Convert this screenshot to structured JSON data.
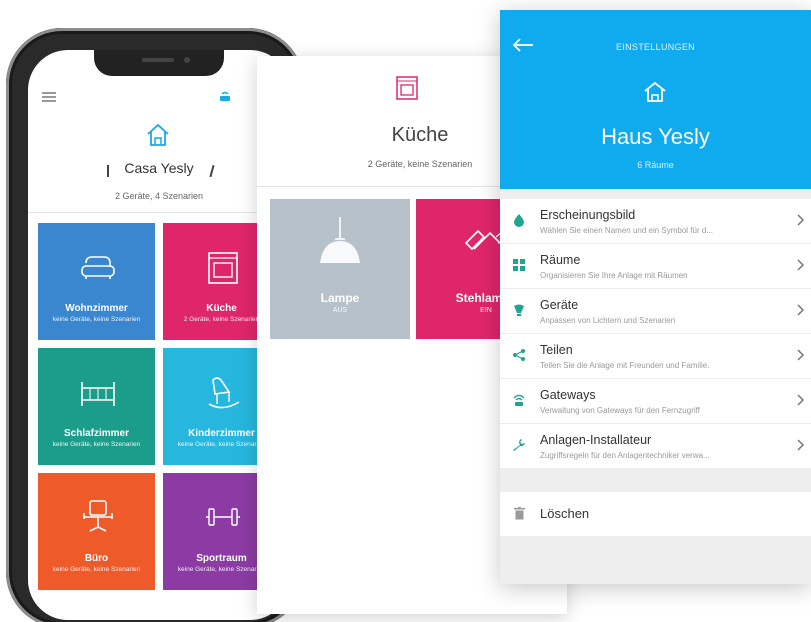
{
  "phone": {
    "title": "Casa Yesly",
    "subtitle": "2 Geräte, 4 Szenarien",
    "rooms": [
      {
        "name": "Wohnzimmer",
        "desc": "keine Geräte, keine Szenarien",
        "color": "#3b87cf",
        "icon": "sofa-icon"
      },
      {
        "name": "Küche",
        "desc": "2 Geräte, keine Szenarien",
        "color": "#e0266b",
        "icon": "oven-icon"
      },
      {
        "name": "Schlafzimmer",
        "desc": "keine Geräte, keine Szenarien",
        "color": "#1c9d8c",
        "icon": "bed-icon"
      },
      {
        "name": "Kinderzimmer",
        "desc": "keine Geräte, keine Szenarien",
        "color": "#27b6de",
        "icon": "rocking-horse-icon"
      },
      {
        "name": "Büro",
        "desc": "keine Geräte, keine Szenarien",
        "color": "#ee5a2a",
        "icon": "office-chair-icon"
      },
      {
        "name": "Sportraum",
        "desc": "keine Geräte, keine Szenarien",
        "color": "#8c3ba4",
        "icon": "dumbbell-icon"
      }
    ]
  },
  "kitchen": {
    "title": "Küche",
    "subtitle": "2 Geräte, keine Szenarien",
    "devices": [
      {
        "name": "Lampe",
        "state": "AUS",
        "color": "#b7c1c9",
        "icon": "pendant-lamp-icon"
      },
      {
        "name": "Stehlampe",
        "state": "EIN",
        "color": "#e0266b",
        "icon": "floor-lamp-icon"
      }
    ]
  },
  "settings": {
    "caption": "EINSTELLUNGEN",
    "title": "Haus Yesly",
    "subtitle": "6 Räume",
    "header_color": "#10aaee",
    "items": [
      {
        "title": "Erscheinungsbild",
        "desc": "Wählen Sie einen Namen und ein Symbol für d...",
        "icon": "paint-drop-icon",
        "color": "#1fa592"
      },
      {
        "title": "Räume",
        "desc": "Organisieren Sie Ihre Anlage mit Räumen",
        "icon": "grid-icon",
        "color": "#1fa592"
      },
      {
        "title": "Geräte",
        "desc": "Anpassen von Lichtern und Szenarien",
        "icon": "bulb-icon",
        "color": "#1fa592"
      },
      {
        "title": "Teilen",
        "desc": "Teilen Sie die Anlage mit Freunden und Familie.",
        "icon": "share-icon",
        "color": "#1fa592"
      },
      {
        "title": "Gateways",
        "desc": "Verwaltung von Gateways für den Fernzugriff",
        "icon": "gateway-icon",
        "color": "#1fa592"
      },
      {
        "title": "Anlagen-Installateur",
        "desc": "Zugriffsregeln für den Anlagentechniker verwa...",
        "icon": "wrench-icon",
        "color": "#1fa592"
      }
    ],
    "delete_label": "Löschen"
  }
}
